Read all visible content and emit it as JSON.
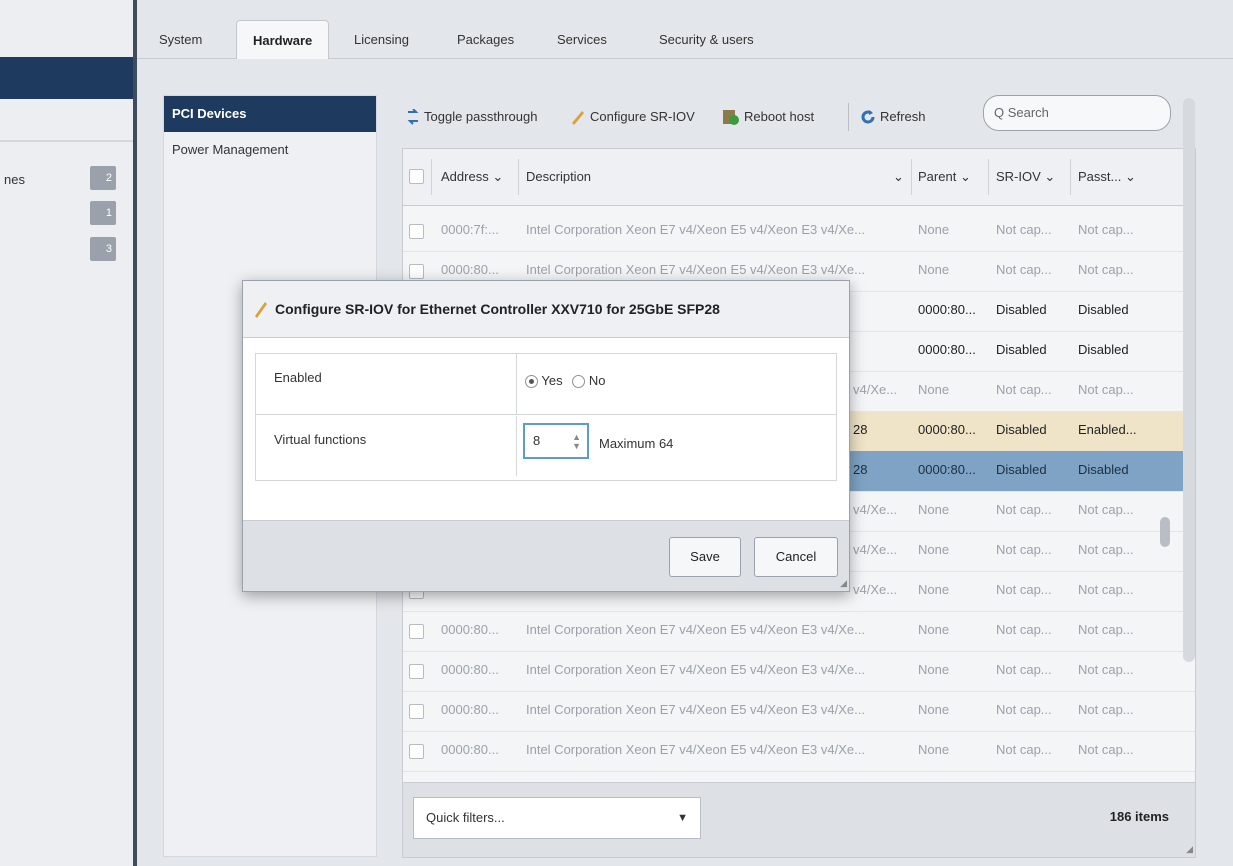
{
  "left_nav": {
    "partial_label": "nes",
    "badges": [
      "2",
      "1",
      "3"
    ]
  },
  "tabs": [
    "System",
    "Hardware",
    "Licensing",
    "Packages",
    "Services",
    "Security & users"
  ],
  "active_tab": "Hardware",
  "subnav": {
    "items": [
      "PCI Devices",
      "Power Management"
    ]
  },
  "toolbar": {
    "toggle_passthrough": "Toggle passthrough",
    "configure_sriov": "Configure SR-IOV",
    "reboot_host": "Reboot host",
    "refresh": "Refresh",
    "search_placeholder": "Q Search"
  },
  "grid": {
    "columns": [
      "Address",
      "Description",
      "Parent",
      "SR-IOV",
      "Passt..."
    ],
    "rows": [
      {
        "address": "0000:7f:...",
        "description": "Intel Corporation Xeon E7 v4/Xeon E5 v4/Xeon E3 v4/Xe...",
        "parent": "None",
        "sriov": "Not cap...",
        "passthrough": "Not cap..."
      },
      {
        "address": "0000:80...",
        "description": "Intel Corporation Xeon E7 v4/Xeon E5 v4/Xeon E3 v4/Xe...",
        "parent": "None",
        "sriov": "Not cap...",
        "passthrough": "Not cap..."
      },
      {
        "address": "",
        "description": "",
        "parent": "0000:80...",
        "sriov": "Disabled",
        "passthrough": "Disabled"
      },
      {
        "address": "",
        "description": "",
        "parent": "0000:80...",
        "sriov": "Disabled",
        "passthrough": "Disabled"
      },
      {
        "address": "",
        "description": "v4/Xe...",
        "parent": "None",
        "sriov": "Not cap...",
        "passthrough": "Not cap..."
      },
      {
        "address": "",
        "description": "28",
        "parent": "0000:80...",
        "sriov": "Disabled",
        "passthrough": "Enabled..."
      },
      {
        "address": "",
        "description": "28",
        "parent": "0000:80...",
        "sriov": "Disabled",
        "passthrough": "Disabled"
      },
      {
        "address": "",
        "description": "v4/Xe...",
        "parent": "None",
        "sriov": "Not cap...",
        "passthrough": "Not cap..."
      },
      {
        "address": "",
        "description": "v4/Xe...",
        "parent": "None",
        "sriov": "Not cap...",
        "passthrough": "Not cap..."
      },
      {
        "address": "",
        "description": "v4/Xe...",
        "parent": "None",
        "sriov": "Not cap...",
        "passthrough": "Not cap..."
      },
      {
        "address": "0000:80...",
        "description": "Intel Corporation Xeon E7 v4/Xeon E5 v4/Xeon E3 v4/Xe...",
        "parent": "None",
        "sriov": "Not cap...",
        "passthrough": "Not cap..."
      },
      {
        "address": "0000:80...",
        "description": "Intel Corporation Xeon E7 v4/Xeon E5 v4/Xeon E3 v4/Xe...",
        "parent": "None",
        "sriov": "Not cap...",
        "passthrough": "Not cap..."
      },
      {
        "address": "0000:80...",
        "description": "Intel Corporation Xeon E7 v4/Xeon E5 v4/Xeon E3 v4/Xe...",
        "parent": "None",
        "sriov": "Not cap...",
        "passthrough": "Not cap..."
      },
      {
        "address": "0000:80...",
        "description": "Intel Corporation Xeon E7 v4/Xeon E5 v4/Xeon E3 v4/Xe...",
        "parent": "None",
        "sriov": "Not cap...",
        "passthrough": "Not cap..."
      }
    ],
    "quick_filters": "Quick filters...",
    "item_count": "186 items"
  },
  "dialog": {
    "title": "Configure SR-IOV for Ethernet Controller XXV710 for 25GbE SFP28",
    "enabled_label": "Enabled",
    "yes_label": "Yes",
    "no_label": "No",
    "enabled_value": "Yes",
    "vf_label": "Virtual functions",
    "vf_value": "8",
    "vf_max": "Maximum 64",
    "save_label": "Save",
    "cancel_label": "Cancel"
  },
  "colors": {
    "selected_nav": "#1f3a5f",
    "selected_row": "#7fa3c4",
    "focus_border": "#5b9ad5"
  }
}
